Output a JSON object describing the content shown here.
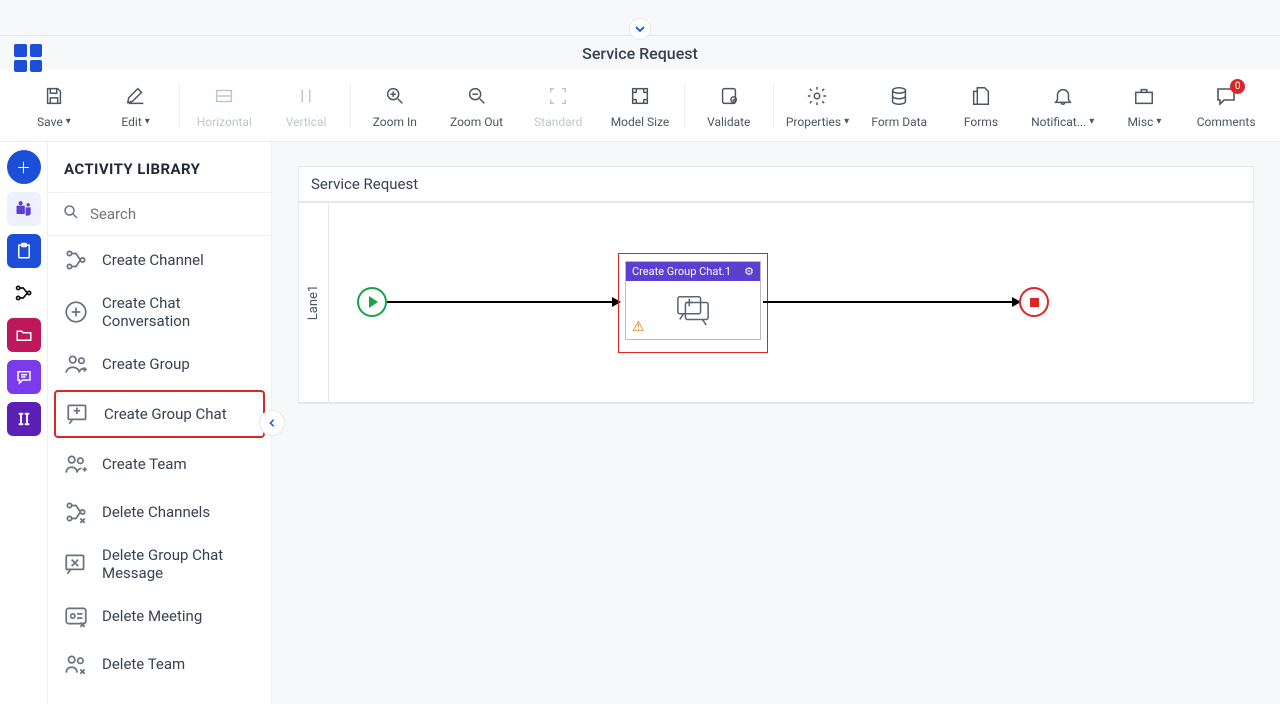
{
  "page_title": "Service Request",
  "toolbar": {
    "save": "Save",
    "edit": "Edit",
    "horizontal": "Horizontal",
    "vertical": "Vertical",
    "zoom_in": "Zoom In",
    "zoom_out": "Zoom Out",
    "standard": "Standard",
    "model_size": "Model Size",
    "validate": "Validate",
    "properties": "Properties",
    "form_data": "Form Data",
    "forms": "Forms",
    "notifications": "Notificat...",
    "misc": "Misc",
    "comments": "Comments",
    "comments_badge": "0"
  },
  "sidebar": {
    "title": "ACTIVITY LIBRARY",
    "search_placeholder": "Search",
    "items": [
      {
        "label": "Create Channel"
      },
      {
        "label": "Create Chat Conversation"
      },
      {
        "label": "Create Group"
      },
      {
        "label": "Create Group Chat"
      },
      {
        "label": "Create Team"
      },
      {
        "label": "Delete Channels"
      },
      {
        "label": "Delete Group Chat Message"
      },
      {
        "label": "Delete Meeting"
      },
      {
        "label": "Delete Team"
      }
    ],
    "selected_index": 3
  },
  "canvas": {
    "title": "Service Request",
    "lane_label": "Lane1",
    "activity_node": {
      "title": "Create Group Chat.1",
      "has_warning": true
    }
  }
}
